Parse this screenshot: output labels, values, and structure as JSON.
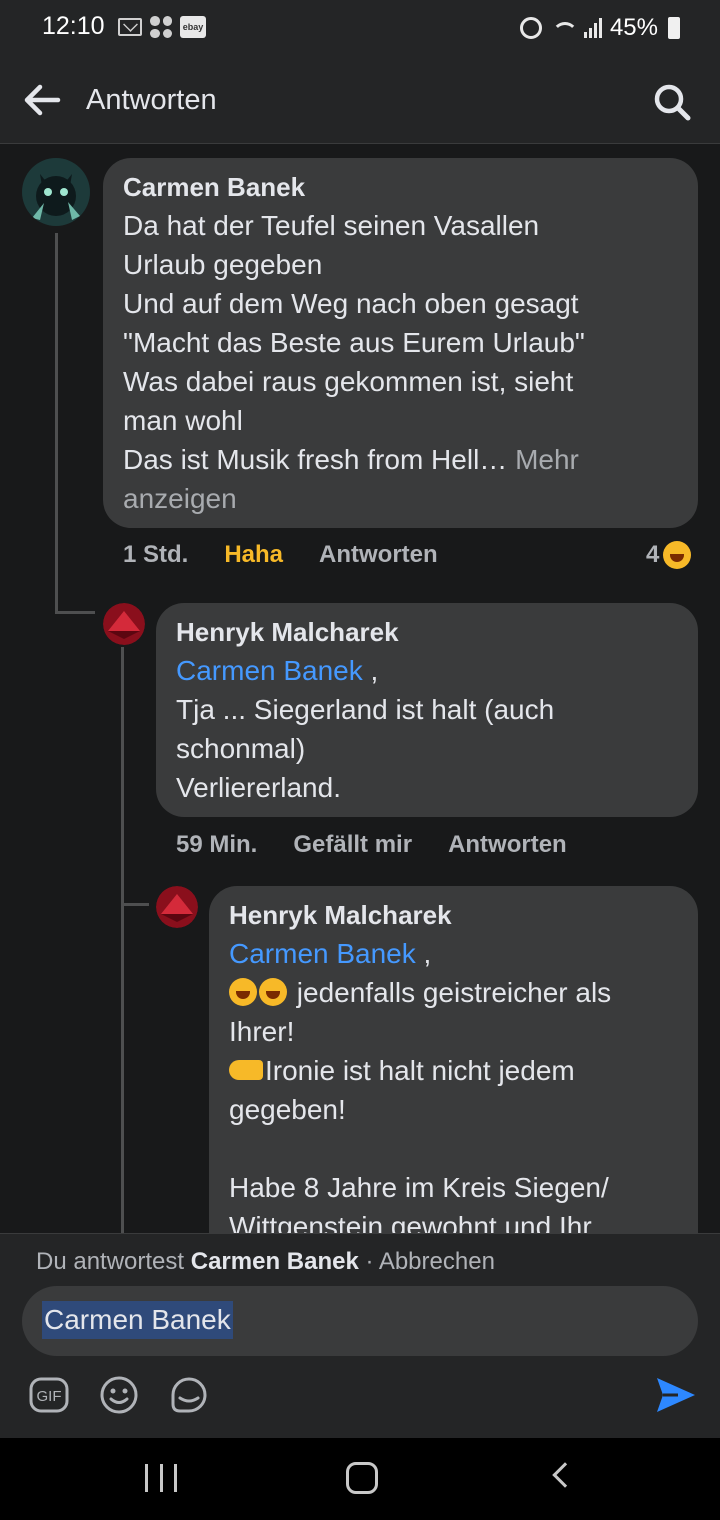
{
  "status_bar": {
    "time": "12:10",
    "ebay_label": "ebay",
    "battery_percent": "45%"
  },
  "header": {
    "title": "Antworten"
  },
  "comments": [
    {
      "author": "Carmen Banek",
      "lines": [
        "Da hat der Teufel seinen Vasallen",
        "Urlaub gegeben",
        "Und auf dem Weg nach oben gesagt",
        "\"Macht das Beste aus Eurem Urlaub\"",
        "Was dabei raus gekommen ist, sieht",
        "man wohl",
        "Das ist Musik fresh from Hell…"
      ],
      "more_label_1": "Mehr",
      "more_label_2": "anzeigen",
      "time": "1 Std.",
      "reaction_action": "Haha",
      "reply_action": "Antworten",
      "reaction_count": "4"
    },
    {
      "author": "Henryk Malcharek",
      "mention": "Carmen Banek",
      "mention_suffix": " ,",
      "lines": [
        "Tja ... Siegerland ist halt (auch",
        "schonmal)",
        "Verliererland."
      ],
      "time": "59 Min.",
      "like_action": "Gefällt mir",
      "reply_action": "Antworten"
    },
    {
      "author": "Henryk Malcharek",
      "mention": "Carmen Banek",
      "mention_suffix": " ,",
      "line1": " jedenfalls geistreicher als",
      "line2": "Ihrer!",
      "line3": "Ironie ist halt nicht jedem",
      "line4": "gegeben!",
      "line5": "Habe 8 Jahre im Kreis Siegen/",
      "line6": "Wittgenstein gewohnt und Ihr"
    }
  ],
  "reply_bar": {
    "hint_prefix": "Du antwortest ",
    "hint_name": "Carmen Banek",
    "hint_separator": " · ",
    "cancel_label": "Abbrechen",
    "input_value": "Carmen Banek",
    "gif_label": "GIF"
  },
  "colors": {
    "background": "#18191a",
    "bubble": "#3a3b3c",
    "mention": "#4599ff",
    "haha": "#f7b928",
    "send": "#2d88ff"
  },
  "icons": [
    "back-arrow-icon",
    "search-icon",
    "gif-icon",
    "emoji-icon",
    "sticker-icon",
    "send-icon"
  ]
}
